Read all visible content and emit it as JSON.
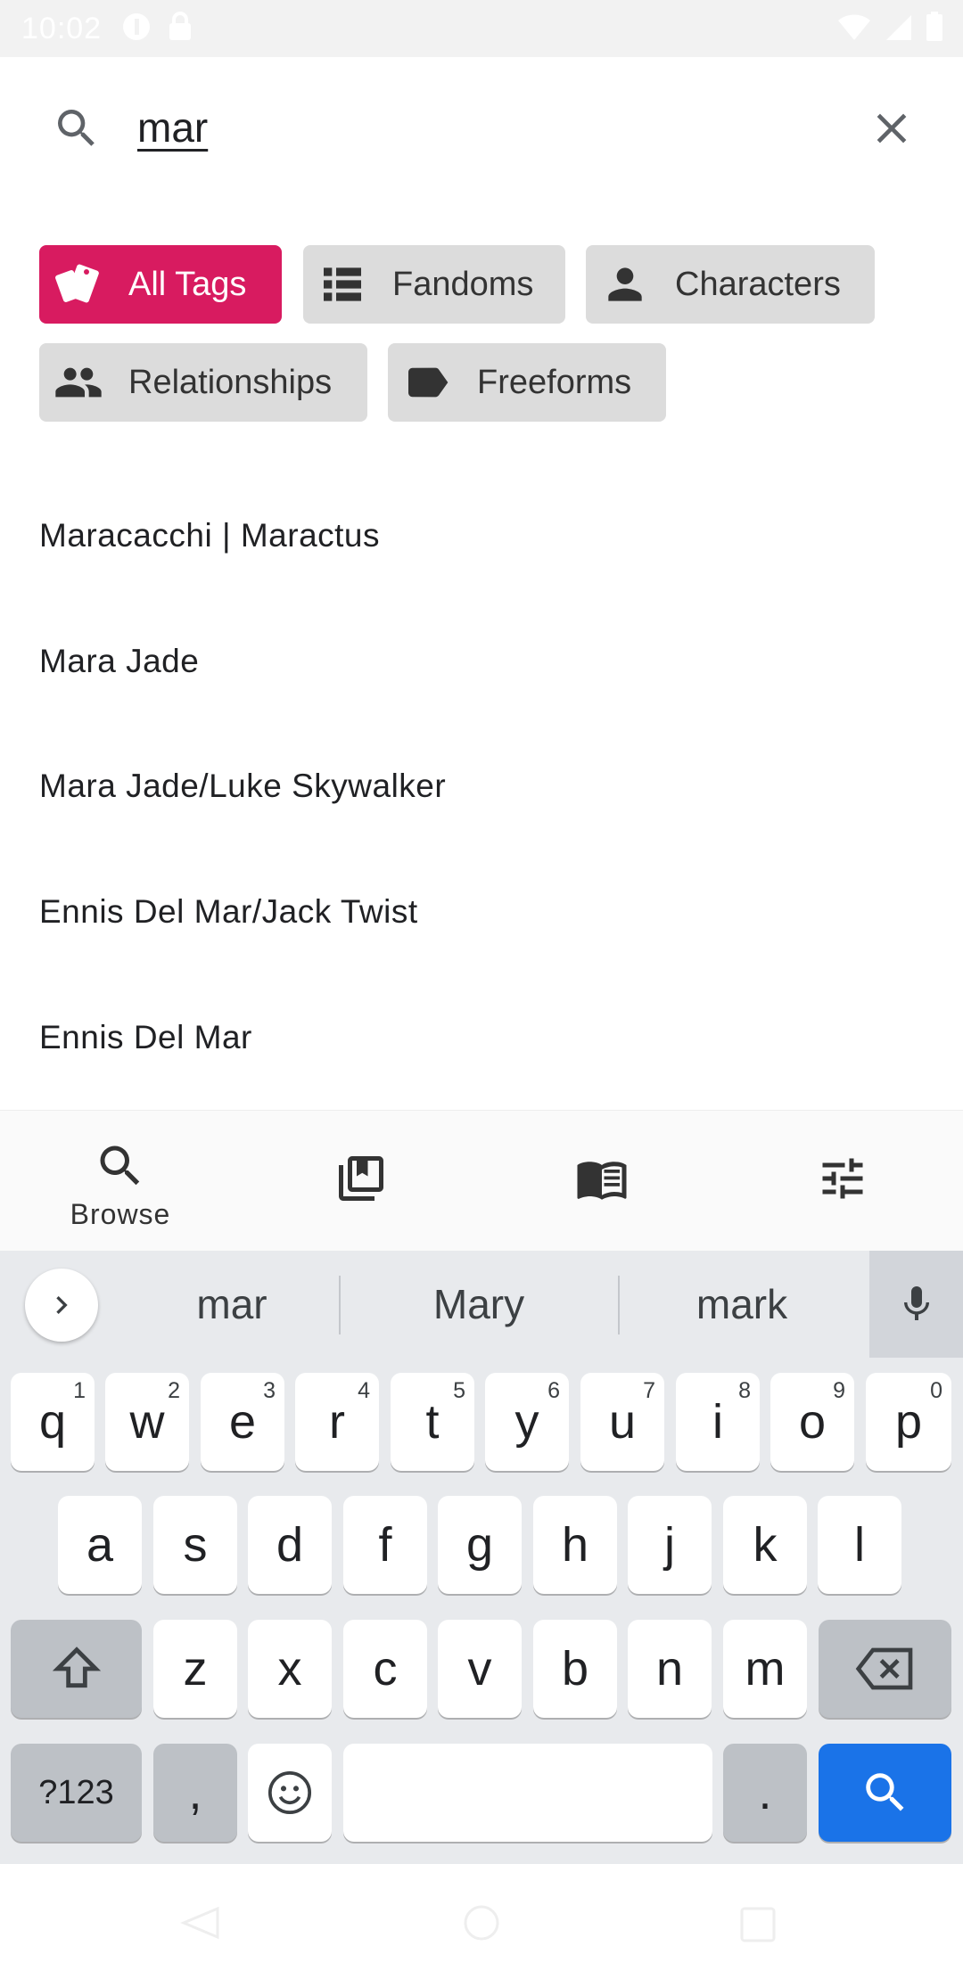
{
  "status_bar": {
    "time": "10:02",
    "icons": [
      "app-icon",
      "lock-icon",
      "wifi-icon",
      "signal-icon",
      "battery-icon"
    ]
  },
  "search": {
    "query": "mar",
    "search_icon": "search-icon",
    "clear_icon": "close-icon"
  },
  "filters": {
    "chips": [
      {
        "label": "All Tags",
        "icon": "tags-icon",
        "active": true
      },
      {
        "label": "Fandoms",
        "icon": "list-icon",
        "active": false
      },
      {
        "label": "Characters",
        "icon": "person-icon",
        "active": false
      },
      {
        "label": "Relationships",
        "icon": "people-icon",
        "active": false
      },
      {
        "label": "Freeforms",
        "icon": "label-icon",
        "active": false
      }
    ],
    "active_color": "#d81b60"
  },
  "results": [
    "Maracacchi | Maractus",
    "Mara Jade",
    "Mara Jade/Luke Skywalker",
    "Ennis Del Mar/Jack Twist",
    "Ennis Del Mar"
  ],
  "bottom_nav": {
    "items": [
      {
        "label": "Browse",
        "icon": "search-icon"
      },
      {
        "label": "",
        "icon": "library-bookmark-icon"
      },
      {
        "label": "",
        "icon": "book-icon"
      },
      {
        "label": "",
        "icon": "tune-icon"
      }
    ]
  },
  "keyboard": {
    "suggestions": [
      "mar",
      "Mary",
      "mark"
    ],
    "row1": [
      {
        "key": "q",
        "hint": "1"
      },
      {
        "key": "w",
        "hint": "2"
      },
      {
        "key": "e",
        "hint": "3"
      },
      {
        "key": "r",
        "hint": "4"
      },
      {
        "key": "t",
        "hint": "5"
      },
      {
        "key": "y",
        "hint": "6"
      },
      {
        "key": "u",
        "hint": "7"
      },
      {
        "key": "i",
        "hint": "8"
      },
      {
        "key": "o",
        "hint": "9"
      },
      {
        "key": "p",
        "hint": "0"
      }
    ],
    "row2": [
      "a",
      "s",
      "d",
      "f",
      "g",
      "h",
      "j",
      "k",
      "l"
    ],
    "row3": [
      "z",
      "x",
      "c",
      "v",
      "b",
      "n",
      "m"
    ],
    "row4": {
      "symbols": "?123",
      "comma": ",",
      "period": "."
    },
    "accent_color": "#1a73e8"
  }
}
